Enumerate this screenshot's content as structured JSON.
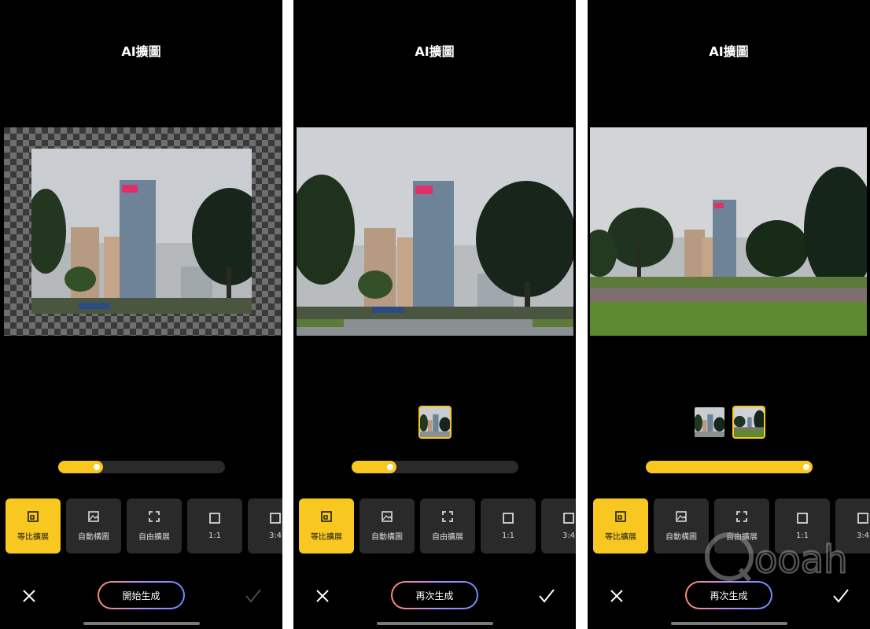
{
  "panels": [
    {
      "title": "AI擴圖",
      "state": "original-with-transparent-border",
      "thumbnails": [],
      "progress": 0.27,
      "options": [
        {
          "label": "等比擴展",
          "icon": "proportional-expand-icon",
          "active": true
        },
        {
          "label": "自動構圖",
          "icon": "image-icon",
          "active": false
        },
        {
          "label": "自由擴展",
          "icon": "free-expand-icon",
          "active": false
        },
        {
          "label": "1:1",
          "icon": "square-icon",
          "active": false
        },
        {
          "label": "3:4",
          "icon": "square-icon",
          "active": false
        }
      ],
      "generate_label": "開始生成",
      "confirm_enabled": false
    },
    {
      "title": "AI擴圖",
      "state": "expanded-result-1",
      "thumbnails": [
        {
          "selected": true
        }
      ],
      "progress": 0.27,
      "options": [
        {
          "label": "等比擴展",
          "icon": "proportional-expand-icon",
          "active": true
        },
        {
          "label": "自動構圖",
          "icon": "image-icon",
          "active": false
        },
        {
          "label": "自由擴展",
          "icon": "free-expand-icon",
          "active": false
        },
        {
          "label": "1:1",
          "icon": "square-icon",
          "active": false
        },
        {
          "label": "3:4",
          "icon": "square-icon",
          "active": false
        }
      ],
      "generate_label": "再次生成",
      "confirm_enabled": true
    },
    {
      "title": "AI擴圖",
      "state": "expanded-result-2",
      "thumbnails": [
        {
          "selected": false
        },
        {
          "selected": true
        }
      ],
      "progress": 1.0,
      "options": [
        {
          "label": "等比擴展",
          "icon": "proportional-expand-icon",
          "active": true
        },
        {
          "label": "自動構圖",
          "icon": "image-icon",
          "active": false
        },
        {
          "label": "自由擴展",
          "icon": "free-expand-icon",
          "active": false
        },
        {
          "label": "1:1",
          "icon": "square-icon",
          "active": false
        },
        {
          "label": "3:4",
          "icon": "square-icon",
          "active": false
        }
      ],
      "generate_label": "再次生成",
      "confirm_enabled": true
    }
  ],
  "watermark": "Qooah",
  "colors": {
    "accent": "#f8c820",
    "panel_bg": "#000000",
    "option_bg": "#2a2a2a"
  }
}
